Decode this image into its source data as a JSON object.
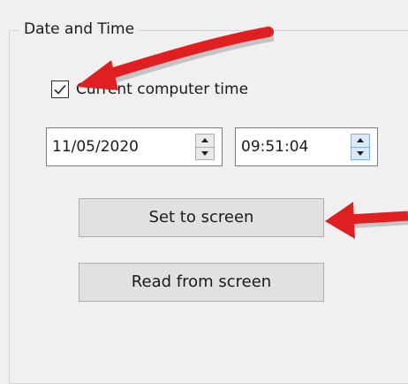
{
  "group": {
    "title": "Date and Time"
  },
  "checkbox": {
    "label": "Current computer time",
    "checked": true
  },
  "date_field": {
    "value": "11/05/2020"
  },
  "time_field": {
    "value": "09:51:04"
  },
  "buttons": {
    "set_label": "Set to screen",
    "read_label": "Read from screen"
  },
  "annotations": {
    "arrow_color": "#e02020"
  }
}
